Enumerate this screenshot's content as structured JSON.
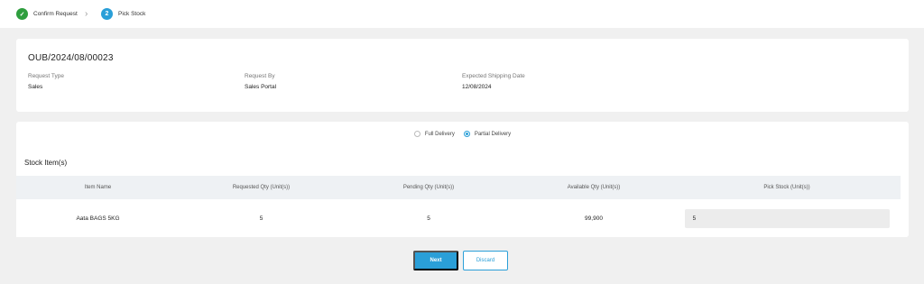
{
  "stepper": {
    "steps": [
      {
        "label": "Confirm Request",
        "state": "done",
        "marker": "✓"
      },
      {
        "label": "Pick Stock",
        "state": "active",
        "marker": "2"
      }
    ],
    "separator": "›"
  },
  "request": {
    "reference": "OUB/2024/08/00023",
    "fields": [
      {
        "label": "Request Type",
        "value": "Sales"
      },
      {
        "label": "Request By",
        "value": "Sales Portal"
      },
      {
        "label": "Expected Shipping Date",
        "value": "12/08/2024"
      }
    ]
  },
  "delivery": {
    "options": [
      {
        "label": "Full Delivery",
        "selected": false
      },
      {
        "label": "Partial Delivery",
        "selected": true
      }
    ]
  },
  "stock": {
    "title": "Stock Item(s)",
    "columns": [
      "Item Name",
      "Requested Qty (Unit(s))",
      "Pending Qty (Unit(s))",
      "Available Qty (Unit(s))",
      "Pick Stock (Unit(s))"
    ],
    "rows": [
      {
        "item": "Aata BAGS 5KG",
        "requested": "5",
        "pending": "5",
        "available": "99,900",
        "pick": "5"
      }
    ]
  },
  "actions": {
    "next_label": "Next",
    "discard_label": "Discard"
  },
  "colors": {
    "accent": "#2a9fd8",
    "success": "#2e9e3e"
  }
}
